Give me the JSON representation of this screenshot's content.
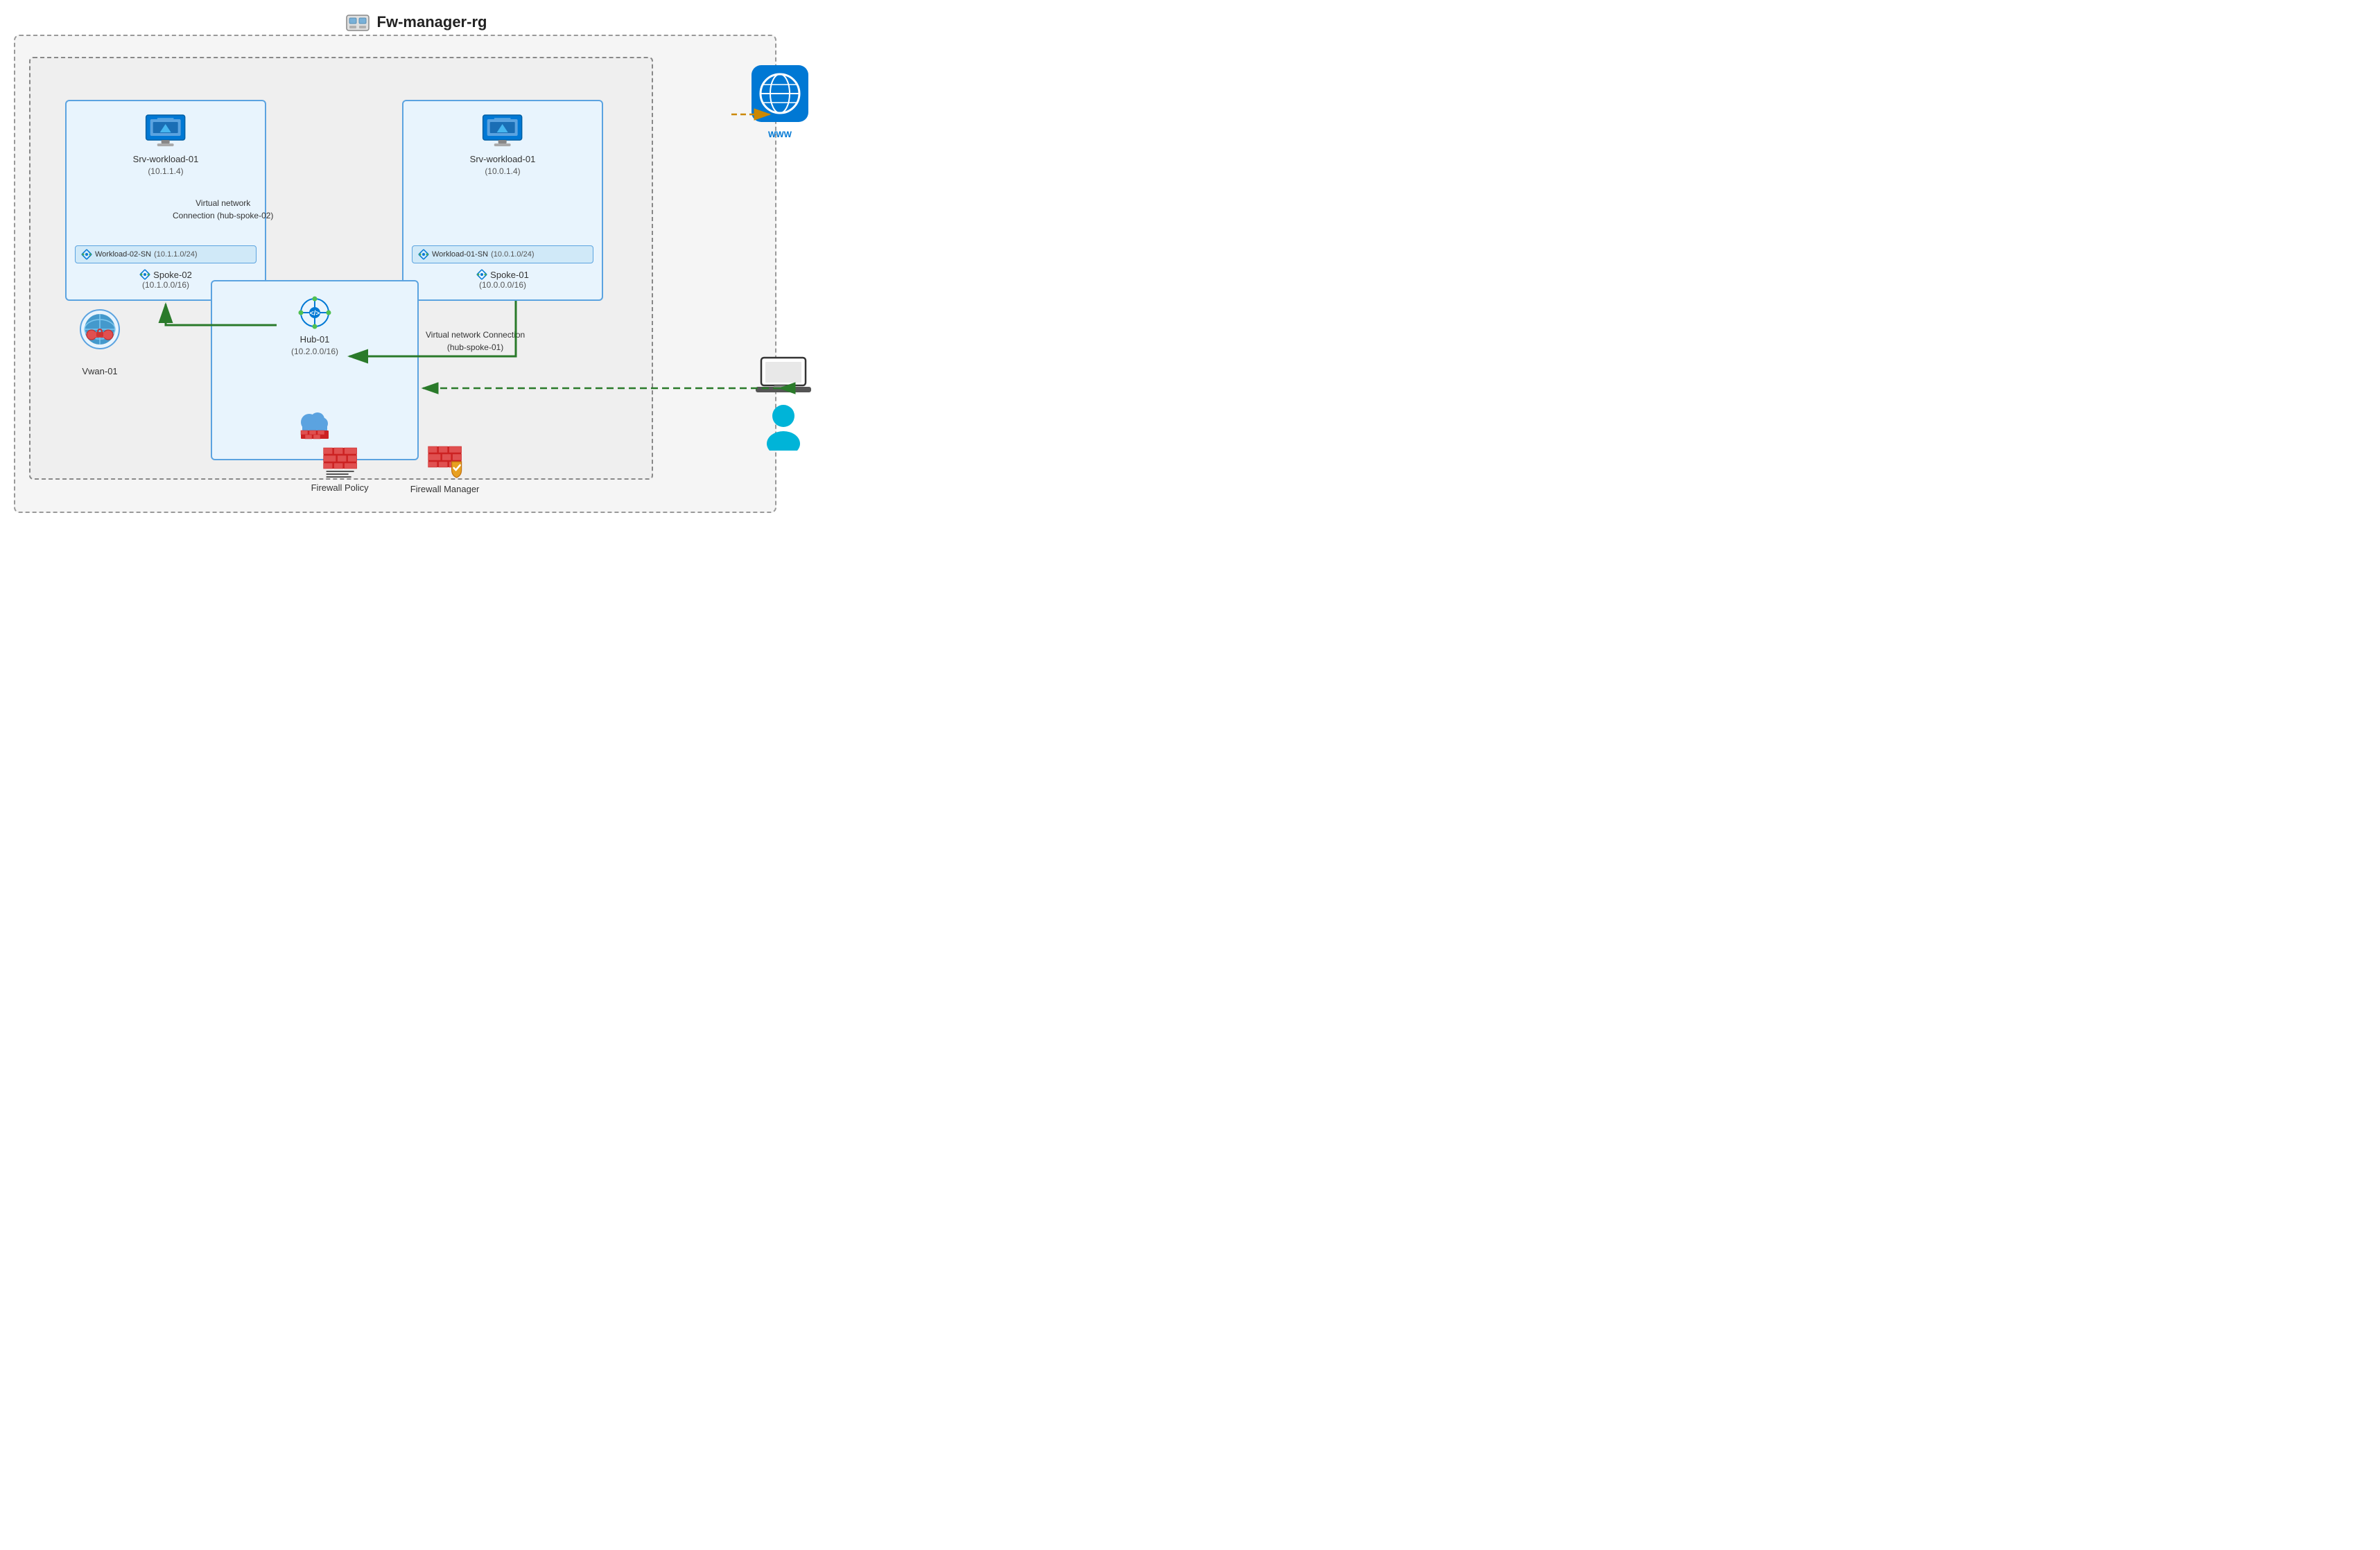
{
  "header": {
    "rg_name": "Fw-manager-rg"
  },
  "spoke02": {
    "vnet_name": "Spoke-02",
    "vnet_cidr": "(10.1.0.0/16)",
    "subnet_name": "Workload-02-SN",
    "subnet_cidr": "(10.1.1.0/24)",
    "vm_name": "Srv-workload-01",
    "vm_ip": "(10.1.1.4)"
  },
  "spoke01": {
    "vnet_name": "Spoke-01",
    "vnet_cidr": "(10.0.0.0/16)",
    "subnet_name": "Workload-01-SN",
    "subnet_cidr": "(10.0.1.0/24)",
    "vm_name": "Srv-workload-01",
    "vm_ip": "(10.0.1.4)"
  },
  "hub": {
    "name": "Hub-01",
    "cidr": "(10.2.0.0/16)"
  },
  "vwan": {
    "name": "Vwan-01"
  },
  "connections": {
    "conn1": "Virtual network\nConnection (hub-spoke-02)",
    "conn2": "Virtual network Connection\n(hub-spoke-01)"
  },
  "legend": {
    "firewall_policy": "Firewall Policy",
    "firewall_manager": "Firewall Manager"
  }
}
